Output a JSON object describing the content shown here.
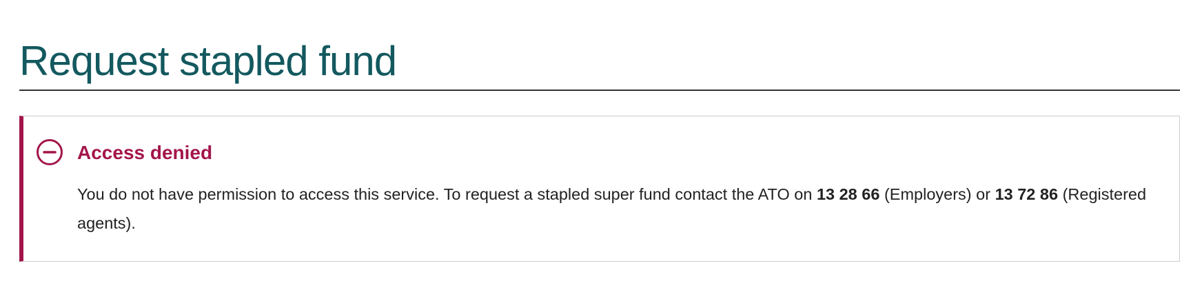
{
  "page": {
    "title": "Request stapled fund"
  },
  "alert": {
    "type": "error",
    "icon": "minus-circle-icon",
    "accent_color": "#a3154a",
    "heading": "Access denied",
    "message_part1": "You do not have permission to access this service. To request a stapled super fund contact the ATO on ",
    "employers_phone": "13 28 66",
    "message_part2": " (Employers) or ",
    "agents_phone": "13 72 86",
    "message_part3": " (Registered agents)."
  },
  "colors": {
    "title": "#13595f",
    "error": "#a3154a",
    "text": "#222222"
  }
}
